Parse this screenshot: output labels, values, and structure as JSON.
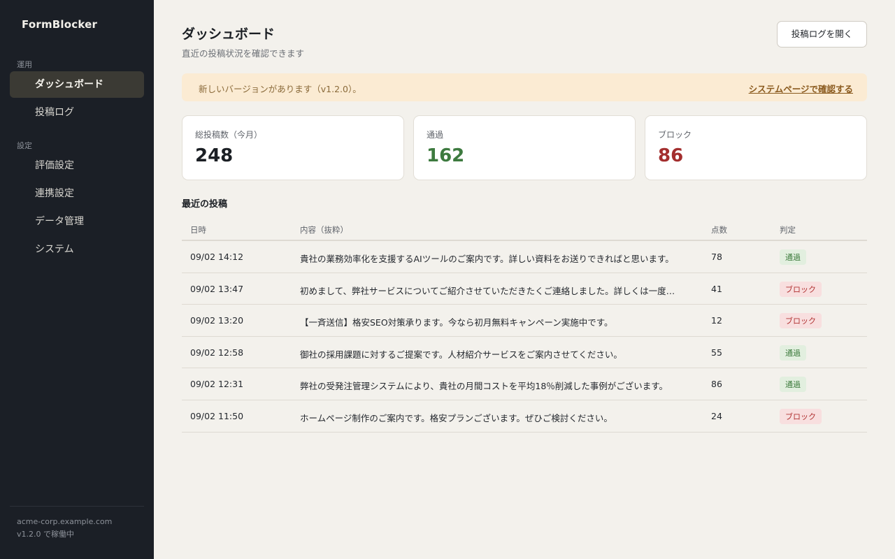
{
  "sidebar": {
    "brand": "FormBlocker",
    "section_ops": "運用",
    "section_settings": "設定",
    "items": [
      {
        "label": "ダッシュボード"
      },
      {
        "label": "投稿ログ"
      },
      {
        "label": "評価設定"
      },
      {
        "label": "連携設定"
      },
      {
        "label": "データ管理"
      },
      {
        "label": "システム"
      }
    ],
    "footer_host": "acme-corp.example.com",
    "footer_status": "v1.2.0 で稼働中"
  },
  "header": {
    "title": "ダッシュボード",
    "subtitle": "直近の投稿状況を確認できます",
    "open_log_button": "投稿ログを開く"
  },
  "notice": {
    "text": "新しいバージョンがあります（v1.2.0）。",
    "link": "システムページで確認する"
  },
  "stats": [
    {
      "label": "総投稿数（今月）",
      "value": "248"
    },
    {
      "label": "通過",
      "value": "162"
    },
    {
      "label": "ブロック",
      "value": "86"
    }
  ],
  "recent": {
    "title": "最近の投稿",
    "headers": [
      "日時",
      "内容（抜粋）",
      "点数",
      "判定"
    ],
    "rows": [
      {
        "date": "09/02 14:12",
        "content": "貴社の業務効率化を支援するAIツールのご案内です。詳しい資料をお送りできればと思います。",
        "score": "78",
        "verdict": "通過"
      },
      {
        "date": "09/02 13:47",
        "content": "初めまして、弊社サービスについてご紹介させていただきたくご連絡しました。詳しくは一度…",
        "score": "41",
        "verdict": "ブロック"
      },
      {
        "date": "09/02 13:20",
        "content": "【一斉送信】格安SEO対策承ります。今なら初月無料キャンペーン実施中です。",
        "score": "12",
        "verdict": "ブロック"
      },
      {
        "date": "09/02 12:58",
        "content": "御社の採用課題に対するご提案です。人材紹介サービスをご案内させてください。",
        "score": "55",
        "verdict": "通過"
      },
      {
        "date": "09/02 12:31",
        "content": "弊社の受発注管理システムにより、貴社の月間コストを平均18％削減した事例がございます。",
        "score": "86",
        "verdict": "通過"
      },
      {
        "date": "09/02 11:50",
        "content": "ホームページ制作のご案内です。格安プランございます。ぜひご検討ください。",
        "score": "24",
        "verdict": "ブロック"
      }
    ]
  }
}
